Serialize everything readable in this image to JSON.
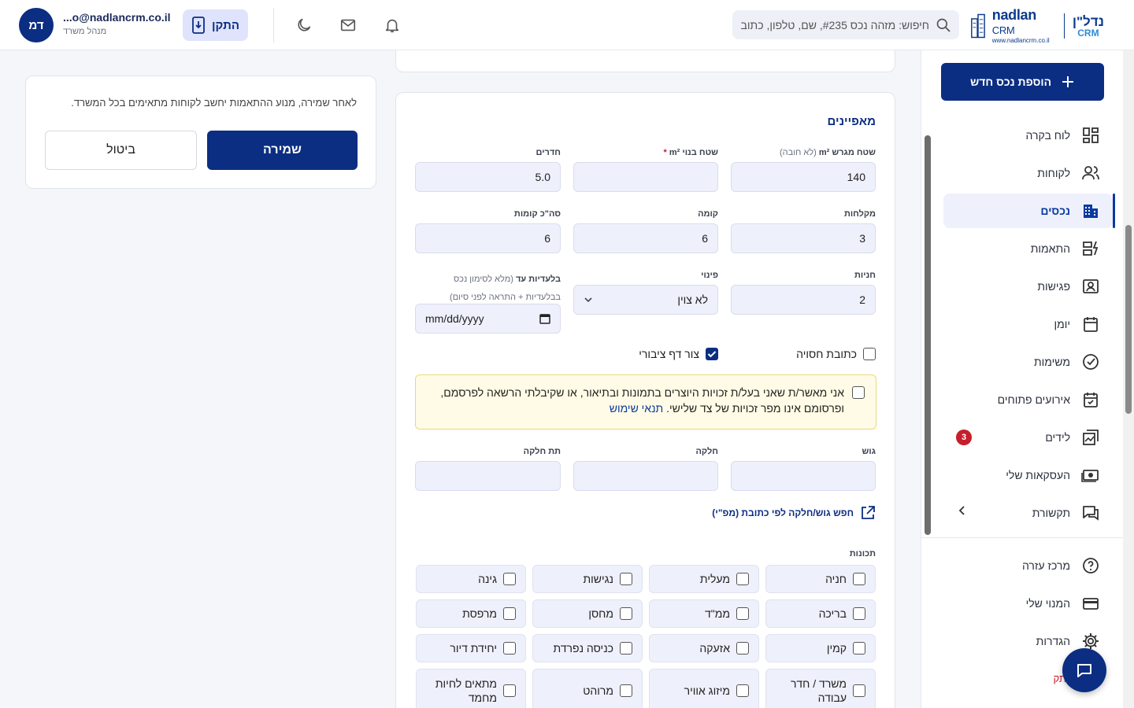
{
  "header": {
    "logo_en": "nadlan",
    "logo_en_suffix": "CRM",
    "logo_url": "www.nadlancrm.co.il",
    "logo_he": "נדל\"ן",
    "logo_he_sub": "CRM",
    "search_placeholder": "חיפוש: מזהה נכס #235, שם, טלפון, כתוב",
    "install_label": "התקן",
    "user_email": "...o@nadlancrm.co.il",
    "user_role": "מנהל משרד",
    "avatar_initials": "דמ"
  },
  "sidebar": {
    "add_button": "הוספת נכס חדש",
    "items": [
      {
        "label": "לוח בקרה",
        "icon": "dashboard-icon"
      },
      {
        "label": "לקוחות",
        "icon": "users-icon"
      },
      {
        "label": "נכסים",
        "icon": "building-icon",
        "active": true
      },
      {
        "label": "התאמות",
        "icon": "match-icon"
      },
      {
        "label": "פגישות",
        "icon": "meeting-icon"
      },
      {
        "label": "יומן",
        "icon": "calendar-icon"
      },
      {
        "label": "משימות",
        "icon": "check-circle-icon"
      },
      {
        "label": "אירועים פתוחים",
        "icon": "event-icon"
      },
      {
        "label": "לידים",
        "icon": "leads-icon",
        "badge": "3"
      },
      {
        "label": "העסקאות שלי",
        "icon": "money-icon"
      },
      {
        "label": "תקשורת",
        "icon": "chat-icon"
      }
    ],
    "bottom_items": [
      {
        "label": "מרכז עזרה",
        "icon": "help-icon"
      },
      {
        "label": "המנוי שלי",
        "icon": "card-icon"
      },
      {
        "label": "הגדרות",
        "icon": "gear-icon"
      }
    ],
    "partial_item": "נתק"
  },
  "save_card": {
    "note": "לאחר שמירה, מנוע ההתאמות יחשב לקוחות מתאימים בכל המשרד.",
    "save_label": "שמירה",
    "cancel_label": "ביטול"
  },
  "form": {
    "section_title": "מאפיינים",
    "lot_area_label": "שטח מגרש m²",
    "lot_area_hint": "(לא חובה)",
    "lot_area_value": "140",
    "built_area_label": "שטח בנוי m²",
    "built_area_required": "*",
    "built_area_value": "",
    "rooms_label": "חדרים",
    "rooms_value": "5.0",
    "showers_label": "מקלחות",
    "showers_value": "3",
    "floor_label": "קומה",
    "floor_value": "6",
    "total_floors_label": "סה\"כ קומות",
    "total_floors_value": "6",
    "parking_label": "חניות",
    "parking_value": "2",
    "vacancy_label": "פינוי",
    "vacancy_value": "לא צוין",
    "exclusive_label": "בלעדיות עד",
    "exclusive_hint1": "(מלא לסימון נכס",
    "exclusive_hint2": "בבלעדיות + התראה לפני סיום)",
    "exclusive_placeholder": "mm/dd/yyyy",
    "hidden_address_label": "כתובת חסויה",
    "public_page_label": "צור דף ציבורי",
    "consent_text": "אני מאשר/ת שאני בעל/ת זכויות היוצרים בתמונות ובתיאור, או שקיבלתי הרשאה לפרסמם, ופרסומם אינו מפר זכויות של צד שלישי.",
    "consent_link": "תנאי שימוש",
    "gush_label": "גוש",
    "helka_label": "חלקה",
    "tat_helka_label": "תת חלקה",
    "gush_search_link": "חפש גוש/חלקה לפי כתובת (מפ\"י)",
    "features_title": "תכונות",
    "features": [
      "חניה",
      "מעלית",
      "נגישות",
      "גינה",
      "בריכה",
      "ממ\"ד",
      "מחסן",
      "מרפסת",
      "קמין",
      "אזעקה",
      "כניסה נפרדת",
      "יחידת דיור",
      "משרד / חדר עבודה",
      "מיזוג אוויר",
      "מרוהט",
      "מתאים לחיות מחמד"
    ]
  },
  "colors": {
    "primary": "#0b2e82",
    "badge": "#c61e2b",
    "input_bg": "#eef0fb"
  }
}
